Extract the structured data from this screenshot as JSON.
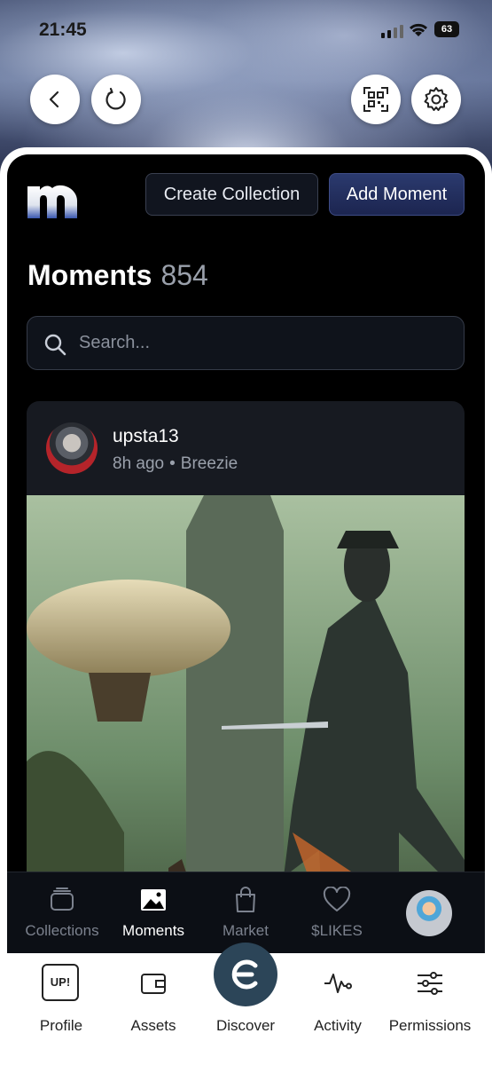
{
  "status": {
    "time": "21:45",
    "battery": "63"
  },
  "header": {
    "create_collection_label": "Create Collection",
    "add_moment_label": "Add Moment",
    "title": "Moments",
    "count": "854",
    "search_placeholder": "Search..."
  },
  "moment": {
    "username": "upsta13",
    "time_ago": "8h ago",
    "separator": "•",
    "source": "Breezie"
  },
  "app_nav": {
    "items": [
      {
        "label": "Collections",
        "icon": "stack-icon"
      },
      {
        "label": "Moments",
        "icon": "image-icon",
        "active": true
      },
      {
        "label": "Market",
        "icon": "shopping-bag-icon"
      },
      {
        "label": "$LIKES",
        "icon": "heart-icon"
      }
    ]
  },
  "system_nav": {
    "profile_badge": "UP!",
    "items": [
      {
        "label": "Profile"
      },
      {
        "label": "Assets"
      },
      {
        "label": "Discover"
      },
      {
        "label": "Activity"
      },
      {
        "label": "Permissions"
      }
    ]
  },
  "colors": {
    "accent": "#2c4558",
    "primary_button": "#1c2550",
    "background": "#000000"
  }
}
